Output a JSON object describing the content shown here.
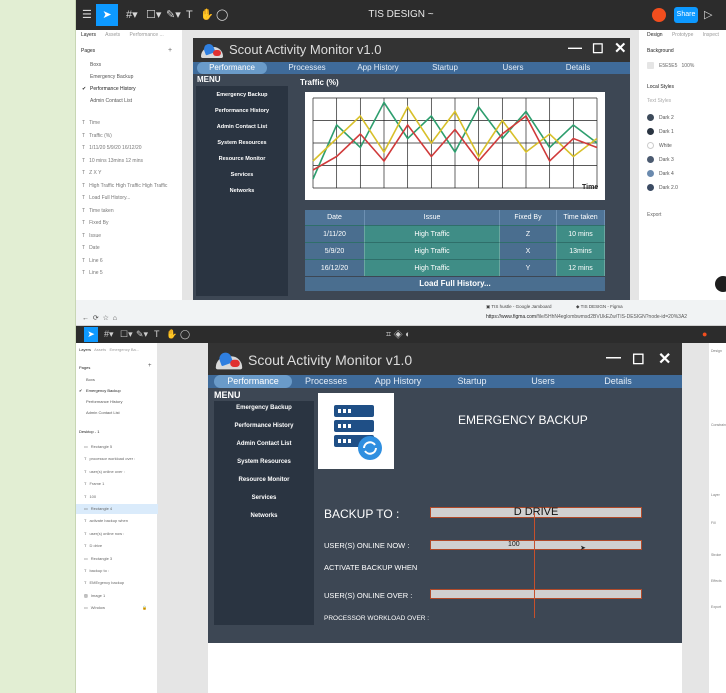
{
  "shot1": {
    "toolbar": {
      "title": "TIS DESIGN ~",
      "icons": [
        "menu-icon",
        "move-icon",
        "frame-icon",
        "shape-icon",
        "pen-icon",
        "text-icon",
        "hand-icon",
        "comment-icon"
      ],
      "share": "Share"
    },
    "left_panel": {
      "tabs": [
        "Layers",
        "Assets",
        "Performance ..."
      ],
      "pages_header": "Pages",
      "pages": [
        "Boxs",
        "Emergency Backup",
        "Performance History",
        "Admin Contact List"
      ],
      "layers": [
        "Time",
        "Traffic (%)",
        "1/11/20 5/9/20 16/12/20",
        "10 mins 13mins 12 mins",
        "Z X Y",
        "High Traffic High Traffic High Traffic",
        "Load Full History...",
        "Time taken",
        "Fixed By",
        "Issue",
        "Date",
        "Line 6",
        "Line 5"
      ]
    },
    "right_panel": {
      "tabs": [
        "Design",
        "Prototype",
        "Inspect"
      ],
      "background_label": "Background",
      "background_value": "E5E5E5",
      "background_opacity": "100%",
      "local_styles_label": "Local Styles",
      "text_styles": "Text Styles",
      "styles": [
        {
          "name": "Dark 2",
          "color": "#3d4a5a"
        },
        {
          "name": "Dark 1",
          "color": "#2a3441"
        },
        {
          "name": "White",
          "color": "#ffffff"
        },
        {
          "name": "Dark 3",
          "color": "#4b5a70"
        },
        {
          "name": "Dark 4",
          "color": "#6a8aae"
        },
        {
          "name": "Dark 2.0",
          "color": "#3b4b63"
        }
      ],
      "export_label": "Export"
    },
    "app": {
      "title": "Scout Activity Monitor v1.0",
      "tabs": [
        "Performance",
        "Processes",
        "App History",
        "Startup",
        "Users",
        "Details"
      ],
      "menu_header": "MENU",
      "menu": [
        "Emergency Backup",
        "Performance History",
        "Admin Contact List",
        "System Resources",
        "Resource Monitor",
        "Services",
        "Networks"
      ],
      "chart_label": "Traffic (%)",
      "time_label": "Time",
      "table": {
        "headers": [
          "Date",
          "Issue",
          "Fixed By",
          "Time taken"
        ],
        "rows": [
          [
            "1/11/20",
            "High Traffic",
            "Z",
            "10 mins"
          ],
          [
            "5/9/20",
            "High Traffic",
            "X",
            "13mins"
          ],
          [
            "16/12/20",
            "High Traffic",
            "Y",
            "12 mins"
          ]
        ]
      },
      "load_more": "Load Full History..."
    }
  },
  "browser": {
    "tabs": [
      "TIS hustle - Google Jamboard",
      "TIS DESIGN - Figma"
    ],
    "url_host": "https://www.figma.com",
    "url_path": "/file/5HhN4eglombwmsd2BVUkEZw/TIS-DESIGN?node-id=20%3A2"
  },
  "shot2": {
    "left_panel": {
      "tabs": [
        "Layers",
        "Assets",
        "Emergency Ba..."
      ],
      "pages_header": "Pages",
      "pages": [
        "Boxs",
        "Emergency Backup",
        "Performance History",
        "Admin Contact List"
      ],
      "frame": "Desktop - 1",
      "layers": [
        "Rectangle 5",
        "processor workload over :",
        "user(s) online over :",
        "Frame 1",
        "100",
        "Rectangle 4",
        "activate backup when",
        "user(s) online now :",
        "D drive",
        "Rectangle 3",
        "backup to :",
        "EMErgency backup",
        "Image 1",
        "Window"
      ]
    },
    "right_panel": {
      "labels": [
        "Design",
        "Constraints",
        "Layer",
        "Fill",
        "Stroke",
        "Effects",
        "Export"
      ]
    },
    "app": {
      "title": "Scout Activity Monitor v1.0",
      "tabs": [
        "Performance",
        "Processes",
        "App History",
        "Startup",
        "Users",
        "Details"
      ],
      "menu_header": "MENU",
      "menu": [
        "Emergency Backup",
        "Performance History",
        "Admin Contact List",
        "System Resources",
        "Resource Monitor",
        "Services",
        "Networks"
      ],
      "heading": "EMERGENCY BACKUP",
      "backup_to": "BACKUP TO :",
      "backup_value": "D DRIVE",
      "users_online_now": "USER(S) ONLINE NOW :",
      "users_online_value": "100",
      "activate_when": "ACTIVATE BACKUP WHEN",
      "users_online_over": "USER(S) ONLINE OVER :",
      "processor_workload": "PROCESSOR WORKLOAD OVER :"
    }
  },
  "chart_data": {
    "type": "line",
    "title": "Traffic (%)",
    "xlabel": "Time",
    "ylabel": "",
    "grid": true,
    "x": [
      0,
      1,
      2,
      3,
      4,
      5,
      6,
      7,
      8,
      9,
      10,
      11,
      12
    ],
    "series": [
      {
        "color": "#2e9e6e",
        "values": [
          10,
          70,
          45,
          95,
          55,
          80,
          40,
          90,
          55,
          85,
          45,
          70,
          50
        ]
      },
      {
        "color": "#d8c02a",
        "values": [
          30,
          55,
          80,
          40,
          90,
          50,
          85,
          35,
          75,
          40,
          60,
          35,
          55
        ]
      },
      {
        "color": "#d03a3a",
        "values": [
          20,
          35,
          60,
          30,
          70,
          35,
          65,
          30,
          60,
          80,
          30,
          55,
          45
        ]
      }
    ],
    "ylim": [
      0,
      100
    ]
  }
}
